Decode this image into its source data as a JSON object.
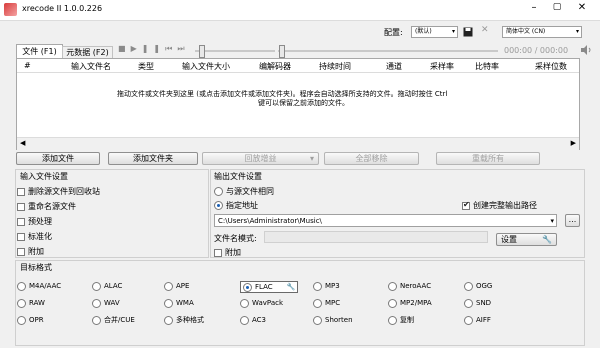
{
  "window": {
    "title": "xrecode II 1.0.0.226"
  },
  "topbar": {
    "config_label": "配置:",
    "config_value": "(默认)",
    "language_value": "简体中文 (CN)"
  },
  "tabs": [
    {
      "label": "文件 (F1)"
    },
    {
      "label": "元数据 (F2)"
    }
  ],
  "player": {
    "time": "000:00 / 000:00"
  },
  "table": {
    "columns": [
      "#",
      "输入文件名",
      "类型",
      "输入文件大小",
      "编解码器",
      "持续时间",
      "通道",
      "采样率",
      "比特率",
      "采样位数"
    ],
    "hint_line1": "拖动文件或文件夹到这里 (或点击添加文件或添加文件夹)。程序会自动选择所支持的文件。拖动时按住 Ctrl",
    "hint_line2": "键可以保留之前添加的文件。"
  },
  "actions": {
    "add_files": "添加文件",
    "add_folder": "添加文件夹",
    "replay_gain": "回放增益",
    "remove_all": "全部移除",
    "reset_all": "重载所有"
  },
  "input_settings": {
    "title": "输入文件设置",
    "options": [
      {
        "label": "删除源文件到回收站",
        "checked": false
      },
      {
        "label": "重命名源文件",
        "checked": false
      },
      {
        "label": "预处理",
        "checked": false
      },
      {
        "label": "标准化",
        "checked": false
      },
      {
        "label": "附加",
        "checked": false
      }
    ]
  },
  "output_settings": {
    "title": "输出文件设置",
    "same_as_source": "与源文件相同",
    "specified_path": "指定地址",
    "create_full_path": "创建完整输出路径",
    "path": "C:\\Users\\Administrator\\Music\\",
    "browse": "...",
    "filename_pattern_label": "文件名模式:",
    "settings_button": "设置",
    "append": "附加"
  },
  "target_format": {
    "title": "目标格式",
    "rows": [
      [
        "M4A/AAC",
        "ALAC",
        "APE",
        "FLAC",
        "MP3",
        "NeroAAC",
        "OGG"
      ],
      [
        "RAW",
        "WAV",
        "WMA",
        "WavPack",
        "MPC",
        "MP2/MPA",
        "SND"
      ],
      [
        "OPR",
        "合并/CUE",
        "多种格式",
        "AC3",
        "Shorten",
        "复制",
        "AIFF"
      ]
    ],
    "selected": "FLAC"
  },
  "colors": {
    "accent": "#1a5fb4",
    "window_bg": "#f0f0f0"
  }
}
